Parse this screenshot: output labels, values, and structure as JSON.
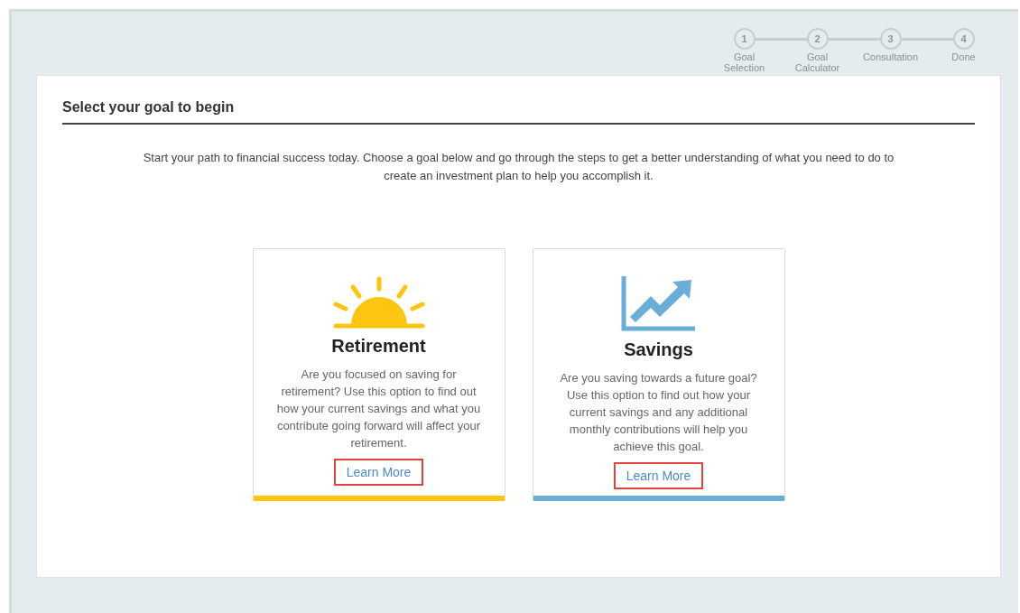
{
  "steps": [
    {
      "number": "1",
      "label": "Goal Selection"
    },
    {
      "number": "2",
      "label": "Goal Calculator"
    },
    {
      "number": "3",
      "label": "Consultation"
    },
    {
      "number": "4",
      "label": "Done"
    }
  ],
  "panel": {
    "title": "Select your goal to begin",
    "intro": "Start your path to financial success today. Choose a goal below and go through the steps to get a better understanding of what you need to do to create an investment plan to help you accomplish it."
  },
  "goals": [
    {
      "kind": "sun",
      "title": "Retirement",
      "description": "Are you focused on saving for retirement? Use this option to find out how your current savings and what you contribute going forward will affect your retirement.",
      "link": "Learn More",
      "color": "#fdc50f"
    },
    {
      "kind": "chart",
      "title": "Savings",
      "description": "Are you saving towards a future goal? Use this option to find out how your current savings and any additional monthly contributions will help you achieve this goal.",
      "link": "Learn More",
      "color": "#6aaed8"
    }
  ]
}
